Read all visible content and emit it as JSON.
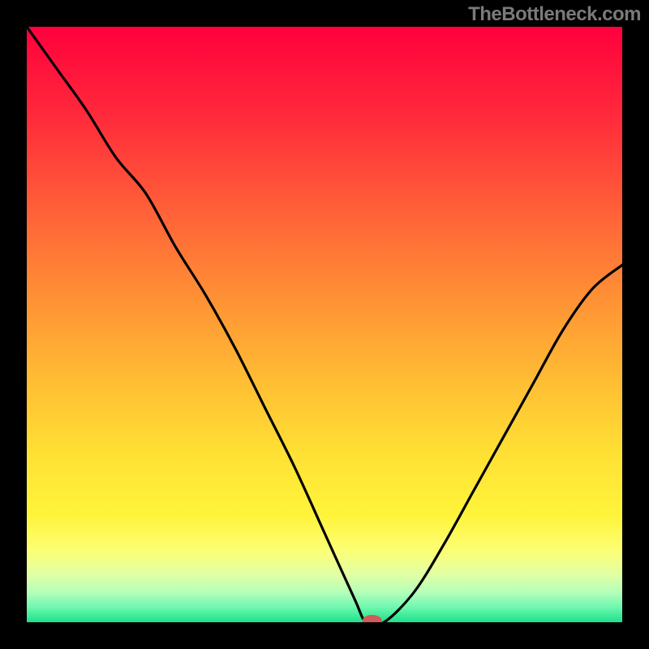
{
  "watermark": "TheBottleneck.com",
  "chart_data": {
    "type": "line",
    "title": "",
    "xlabel": "",
    "ylabel": "",
    "xlim": [
      0,
      100
    ],
    "ylim": [
      0,
      100
    ],
    "x": [
      0,
      5,
      10,
      15,
      20,
      25,
      30,
      35,
      40,
      45,
      50,
      55,
      57,
      60,
      65,
      70,
      75,
      80,
      85,
      90,
      95,
      100
    ],
    "values": [
      100,
      93,
      86,
      78,
      72,
      63,
      55,
      46,
      36,
      26,
      15,
      4,
      0,
      0,
      5,
      13,
      22,
      31,
      40,
      49,
      56,
      60
    ],
    "background_gradient": {
      "stops": [
        {
          "pos": 0.0,
          "color": "#ff003d"
        },
        {
          "pos": 0.15,
          "color": "#ff2a3b"
        },
        {
          "pos": 0.3,
          "color": "#ff5d38"
        },
        {
          "pos": 0.45,
          "color": "#ff8f35"
        },
        {
          "pos": 0.6,
          "color": "#ffbf33"
        },
        {
          "pos": 0.72,
          "color": "#ffe134"
        },
        {
          "pos": 0.82,
          "color": "#fff43a"
        },
        {
          "pos": 0.88,
          "color": "#fcff75"
        },
        {
          "pos": 0.92,
          "color": "#e1ffa5"
        },
        {
          "pos": 0.95,
          "color": "#b4ffba"
        },
        {
          "pos": 0.975,
          "color": "#6ef7af"
        },
        {
          "pos": 1.0,
          "color": "#1ae28a"
        }
      ]
    },
    "marker": {
      "x": 58,
      "y": 0,
      "color": "#d15a5a",
      "rx": 12,
      "ry": 7
    }
  }
}
